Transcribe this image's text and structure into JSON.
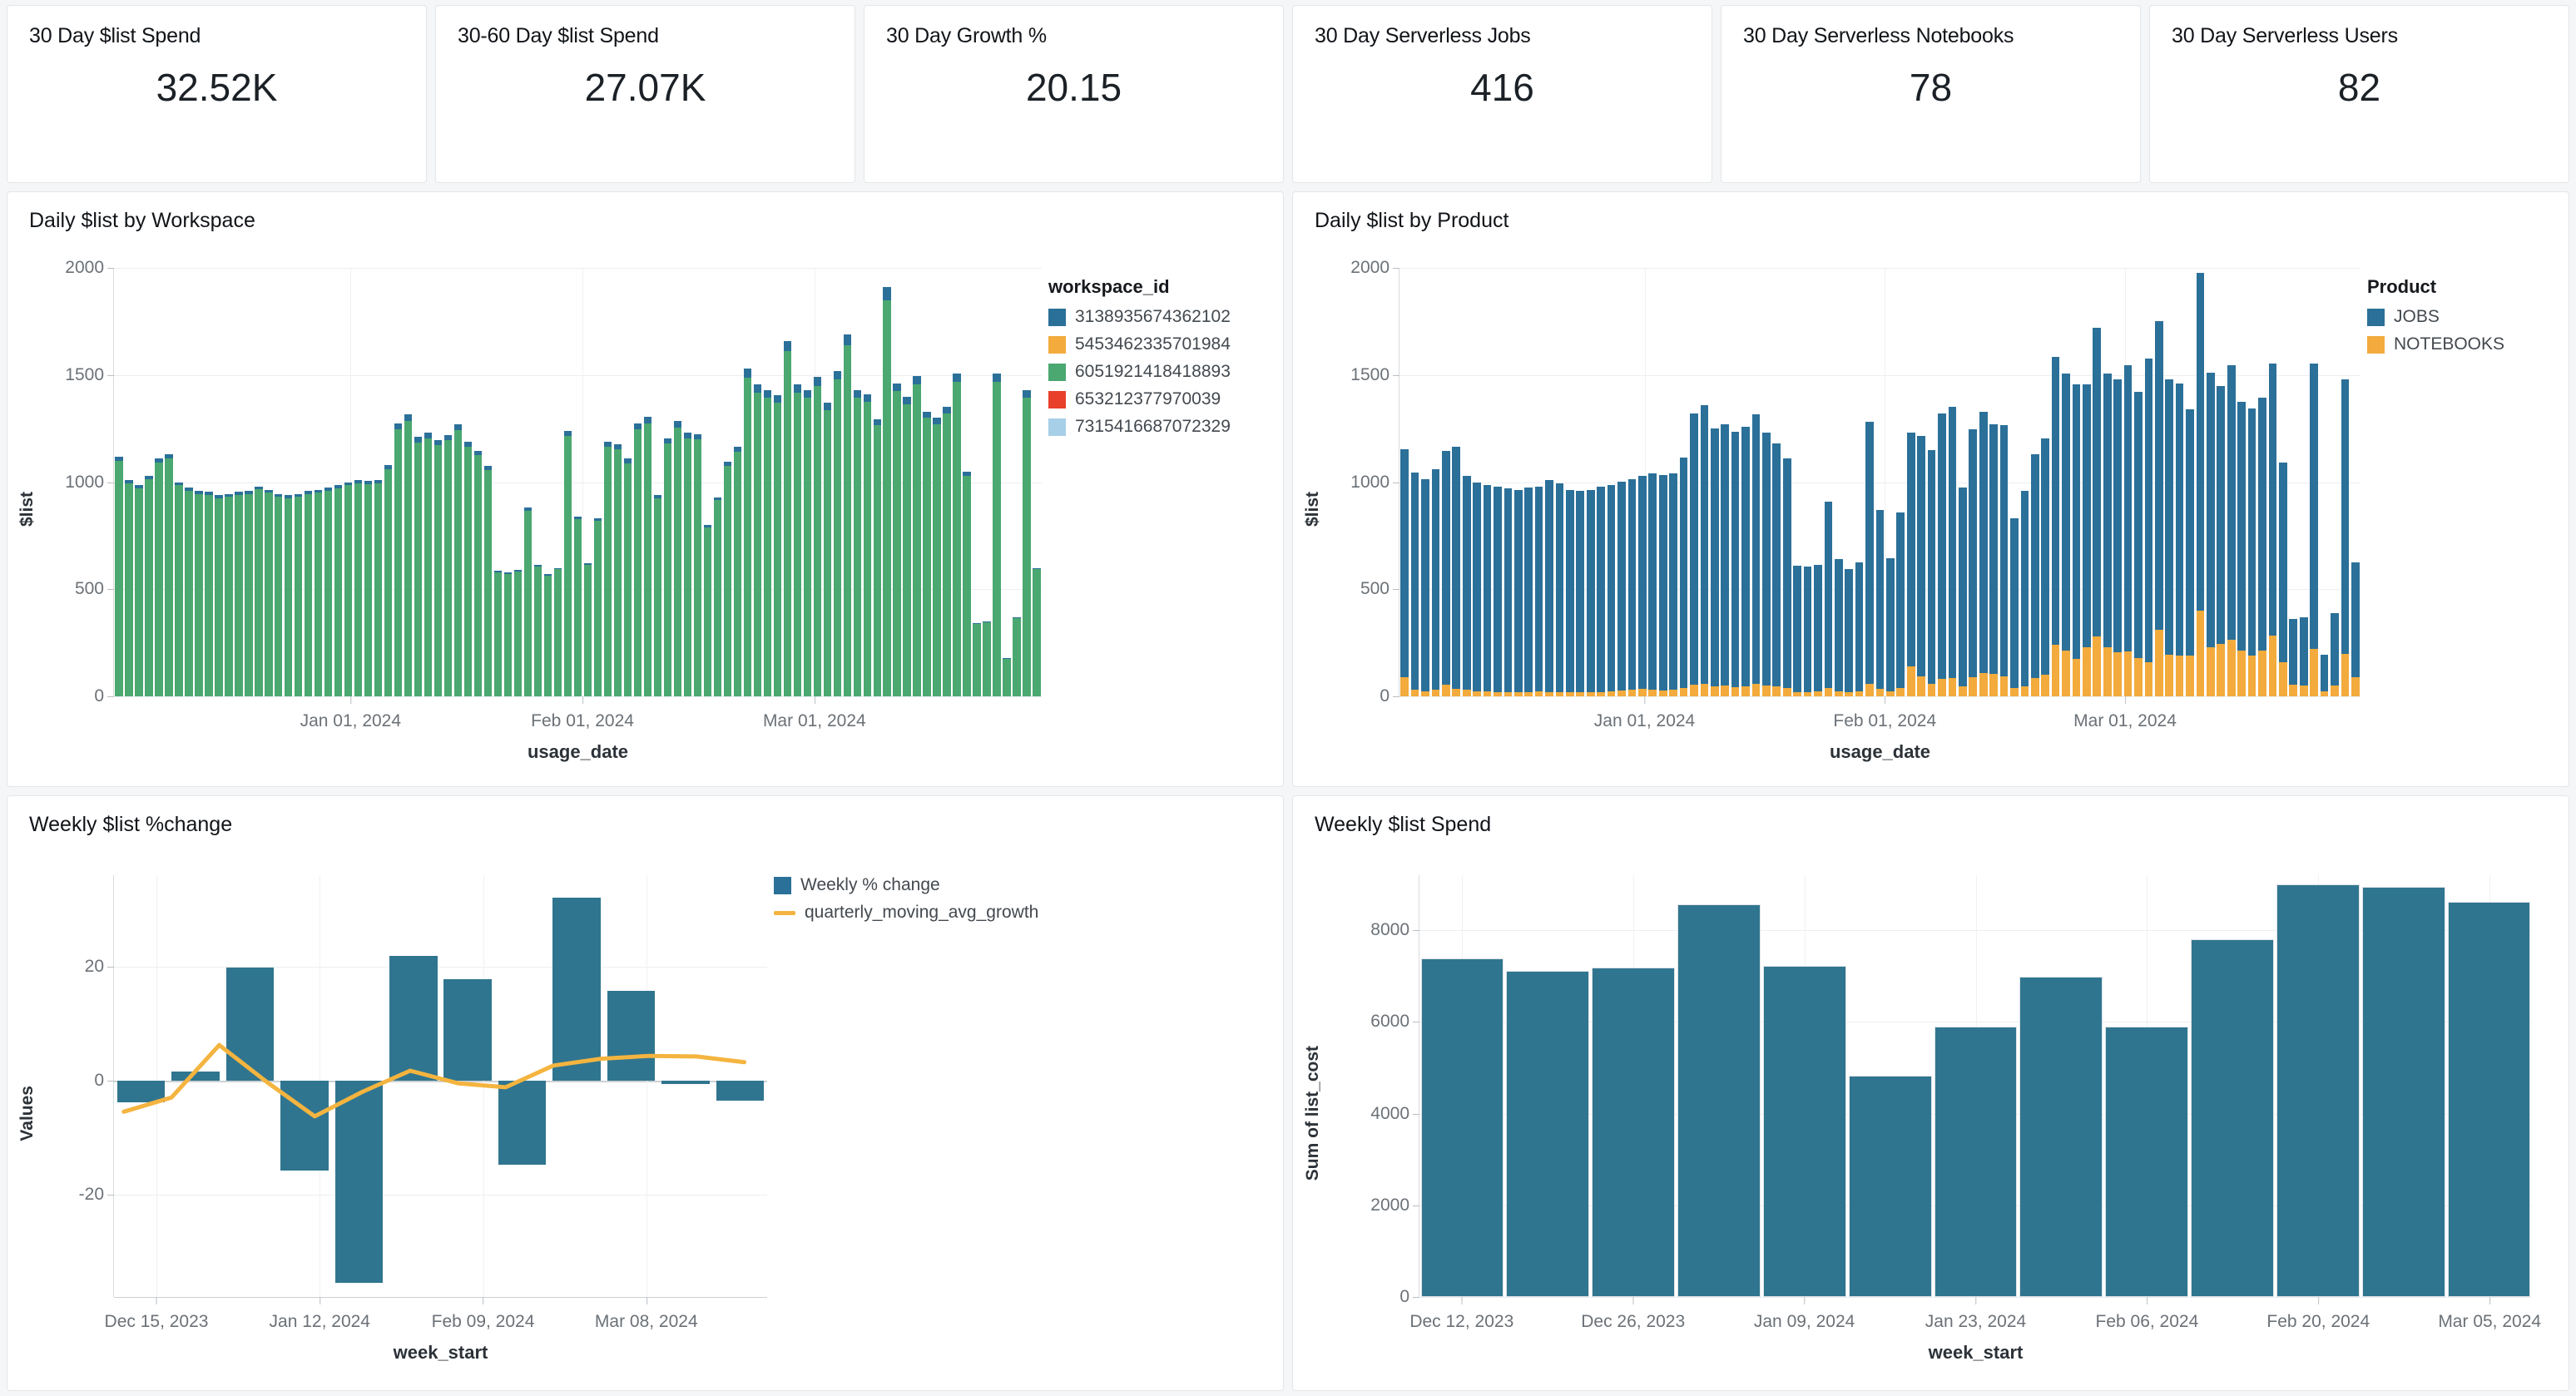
{
  "kpis": [
    {
      "title": "30 Day $list Spend",
      "value": "32.52K"
    },
    {
      "title": "30-60 Day $list Spend",
      "value": "27.07K"
    },
    {
      "title": "30 Day Growth %",
      "value": "20.15"
    },
    {
      "title": "30 Day Serverless Jobs",
      "value": "416"
    },
    {
      "title": "30 Day Serverless Notebooks",
      "value": "78"
    },
    {
      "title": "30 Day Serverless Users",
      "value": "82"
    }
  ],
  "colors": {
    "blue": "#2b7099",
    "orange": "#f2ab3c",
    "green": "#4aa870",
    "red": "#e8402a",
    "lightblue": "#a7cfe8",
    "bar_blue": "#30758f",
    "line_orange": "#f4b43f",
    "grid": "#eceef0",
    "axis_text": "#6b7177"
  },
  "charts": {
    "daily_workspace": {
      "title": "Daily $list by Workspace",
      "legend_title": "workspace_id",
      "legend": [
        {
          "label": "3138935674362102",
          "color": "#2b7099"
        },
        {
          "label": "5453462335701984",
          "color": "#f2ab3c"
        },
        {
          "label": "6051921418418893",
          "color": "#4aa870"
        },
        {
          "label": "653212377970039",
          "color": "#e8402a"
        },
        {
          "label": "7315416687072329",
          "color": "#a7cfe8"
        }
      ]
    },
    "daily_product": {
      "title": "Daily $list by Product",
      "legend_title": "Product",
      "legend": [
        {
          "label": "JOBS",
          "color": "#2b7099"
        },
        {
          "label": "NOTEBOOKS",
          "color": "#f2ab3c"
        }
      ]
    },
    "weekly_change": {
      "title": "Weekly $list %change",
      "legend": [
        {
          "label": "Weekly % change",
          "color": "#2b7099",
          "kind": "swatch"
        },
        {
          "label": "quarterly_moving_avg_growth",
          "color": "#f4b43f",
          "kind": "line"
        }
      ]
    },
    "weekly_spend": {
      "title": "Weekly $list Spend"
    }
  },
  "chart_data": [
    {
      "id": "daily_workspace",
      "type": "bar",
      "stacked": true,
      "title": "Daily $list by Workspace",
      "xlabel": "usage_date",
      "ylabel": "$list",
      "ylim": [
        0,
        2000
      ],
      "yticks": [
        0,
        500,
        1000,
        1500,
        2000
      ],
      "xticks": [
        "Jan 01, 2024",
        "Feb 01, 2024",
        "Mar 01, 2024"
      ],
      "xtick_positions": [
        0.255,
        0.505,
        0.755
      ],
      "legend_title": "workspace_id",
      "legend": [
        "3138935674362102",
        "5453462335701984",
        "6051921418418893",
        "653212377970039",
        "7315416687072329"
      ],
      "series": [
        {
          "name": "6051921418418893",
          "color": "#4aa870",
          "values": [
            1120,
            1010,
            985,
            1030,
            1110,
            1130,
            1000,
            975,
            960,
            955,
            940,
            945,
            955,
            960,
            980,
            965,
            945,
            940,
            945,
            960,
            965,
            975,
            985,
            1000,
            1010,
            1005,
            1010,
            1080,
            1275,
            1315,
            1210,
            1230,
            1195,
            1220,
            1270,
            1190,
            1145,
            1075,
            585,
            580,
            590,
            880,
            615,
            570,
            600,
            1240,
            840,
            620,
            830,
            1190,
            1175,
            1110,
            1275,
            1305,
            940,
            1205,
            1285,
            1230,
            1225,
            800,
            930,
            1095,
            1165,
            1530,
            1455,
            1430,
            1405,
            1660,
            1455,
            1430,
            1490,
            1370,
            1520,
            1690,
            1430,
            1410,
            1295,
            1910,
            1460,
            1400,
            1495,
            1330,
            1300,
            1350,
            1505,
            1050,
            340,
            350,
            1505,
            180,
            370,
            1430,
            600
          ],
          "caps": [
            35,
            35,
            30,
            30,
            35,
            35,
            30,
            30,
            30,
            30,
            30,
            30,
            30,
            30,
            30,
            30,
            30,
            30,
            30,
            30,
            30,
            30,
            30,
            30,
            30,
            30,
            30,
            35,
            45,
            45,
            40,
            40,
            40,
            40,
            45,
            40,
            35,
            35,
            25,
            25,
            25,
            30,
            25,
            25,
            25,
            40,
            30,
            25,
            30,
            40,
            40,
            40,
            45,
            45,
            35,
            40,
            45,
            40,
            40,
            30,
            30,
            35,
            40,
            55,
            50,
            50,
            50,
            60,
            50,
            50,
            55,
            50,
            55,
            60,
            50,
            50,
            45,
            65,
            50,
            50,
            50,
            45,
            45,
            45,
            50,
            40,
            20,
            20,
            50,
            15,
            20,
            50,
            25
          ]
        }
      ]
    },
    {
      "id": "daily_product",
      "type": "bar",
      "stacked": true,
      "title": "Daily $list by Product",
      "xlabel": "usage_date",
      "ylabel": "$list",
      "ylim": [
        0,
        2000
      ],
      "yticks": [
        0,
        500,
        1000,
        1500,
        2000
      ],
      "xticks": [
        "Jan 01, 2024",
        "Feb 01, 2024",
        "Mar 01, 2024"
      ],
      "xtick_positions": [
        0.255,
        0.505,
        0.755
      ],
      "legend_title": "Product",
      "series": [
        {
          "name": "NOTEBOOKS",
          "color": "#f2ab3c",
          "values": [
            90,
            30,
            25,
            30,
            55,
            35,
            30,
            25,
            25,
            20,
            18,
            20,
            20,
            22,
            20,
            18,
            18,
            18,
            18,
            20,
            22,
            28,
            30,
            35,
            32,
            28,
            30,
            40,
            55,
            60,
            48,
            50,
            42,
            45,
            60,
            50,
            45,
            40,
            20,
            20,
            22,
            38,
            22,
            20,
            25,
            60,
            35,
            22,
            40,
            140,
            95,
            60,
            80,
            85,
            45,
            90,
            110,
            105,
            95,
            40,
            48,
            85,
            100,
            240,
            215,
            175,
            230,
            280,
            230,
            205,
            210,
            180,
            160,
            310,
            195,
            190,
            190,
            400,
            230,
            245,
            265,
            215,
            190,
            215,
            285,
            160,
            55,
            50,
            220,
            25,
            50,
            200,
            90
          ]
        },
        {
          "name": "JOBS",
          "color": "#2b7099",
          "values": [
            1065,
            1015,
            990,
            1030,
            1090,
            1130,
            1000,
            975,
            960,
            960,
            952,
            945,
            955,
            958,
            990,
            977,
            947,
            942,
            947,
            960,
            963,
            975,
            985,
            995,
            1008,
            1007,
            1010,
            1075,
            1265,
            1300,
            1202,
            1220,
            1193,
            1215,
            1255,
            1180,
            1135,
            1070,
            590,
            585,
            593,
            872,
            618,
            575,
            600,
            1220,
            835,
            623,
            820,
            1090,
            1120,
            1090,
            1240,
            1265,
            930,
            1155,
            1220,
            1165,
            1170,
            790,
            912,
            1045,
            1105,
            1345,
            1290,
            1280,
            1225,
            1440,
            1275,
            1275,
            1335,
            1240,
            1415,
            1440,
            1285,
            1270,
            1150,
            1575,
            1280,
            1205,
            1280,
            1160,
            1155,
            1180,
            1270,
            930,
            305,
            320,
            1335,
            170,
            340,
            1280,
            535
          ]
        }
      ]
    },
    {
      "id": "weekly_change",
      "type": "bar",
      "title": "Weekly $list %change",
      "xlabel": "week_start",
      "ylabel": "Values",
      "ylim": [
        -38,
        36
      ],
      "yticks": [
        -20,
        0,
        20
      ],
      "xticks": [
        "Dec 15, 2023",
        "Jan 12, 2024",
        "Feb 09, 2024",
        "Mar 08, 2024"
      ],
      "xtick_positions": [
        0.065,
        0.315,
        0.565,
        0.815
      ],
      "series": [
        {
          "name": "Weekly % change",
          "color": "#30758f",
          "values": [
            -3.8,
            1.5,
            19.8,
            -15.8,
            -35.5,
            21.9,
            17.8,
            -14.8,
            32.0,
            15.7,
            -0.6,
            -3.5
          ]
        }
      ],
      "line_series": {
        "name": "quarterly_moving_avg_growth",
        "color": "#f4b43f",
        "values": [
          -5.5,
          -3.0,
          6.2,
          -0.3,
          -6.3,
          -2.0,
          1.7,
          -0.5,
          -1.2,
          2.6,
          3.8,
          4.3,
          4.2,
          3.2
        ]
      }
    },
    {
      "id": "weekly_spend",
      "type": "bar",
      "title": "Weekly $list Spend",
      "xlabel": "week_start",
      "ylabel": "Sum of list_cost",
      "ylim": [
        0,
        9200
      ],
      "yticks": [
        0,
        2000,
        4000,
        6000,
        8000
      ],
      "xticks": [
        "Dec 12, 2023",
        "Dec 26, 2023",
        "Jan 09, 2024",
        "Jan 23, 2024",
        "Feb 06, 2024",
        "Feb 20, 2024",
        "Mar 05, 2024"
      ],
      "xtick_positions": [
        0.038,
        0.192,
        0.346,
        0.5,
        0.654,
        0.808,
        0.962
      ],
      "categories": [
        "Dec 12, 2023",
        "Dec 19, 2023",
        "Dec 26, 2023",
        "Jan 02, 2024",
        "Jan 09, 2024",
        "Jan 16, 2024",
        "Jan 23, 2024",
        "Jan 30, 2024",
        "Feb 06, 2024",
        "Feb 13, 2024",
        "Feb 20, 2024",
        "Feb 27, 2024",
        "Mar 05, 2024"
      ],
      "values": [
        7380,
        7120,
        7180,
        8560,
        7220,
        4820,
        5900,
        6980,
        5900,
        7800,
        9000,
        8950,
        8620
      ]
    }
  ]
}
